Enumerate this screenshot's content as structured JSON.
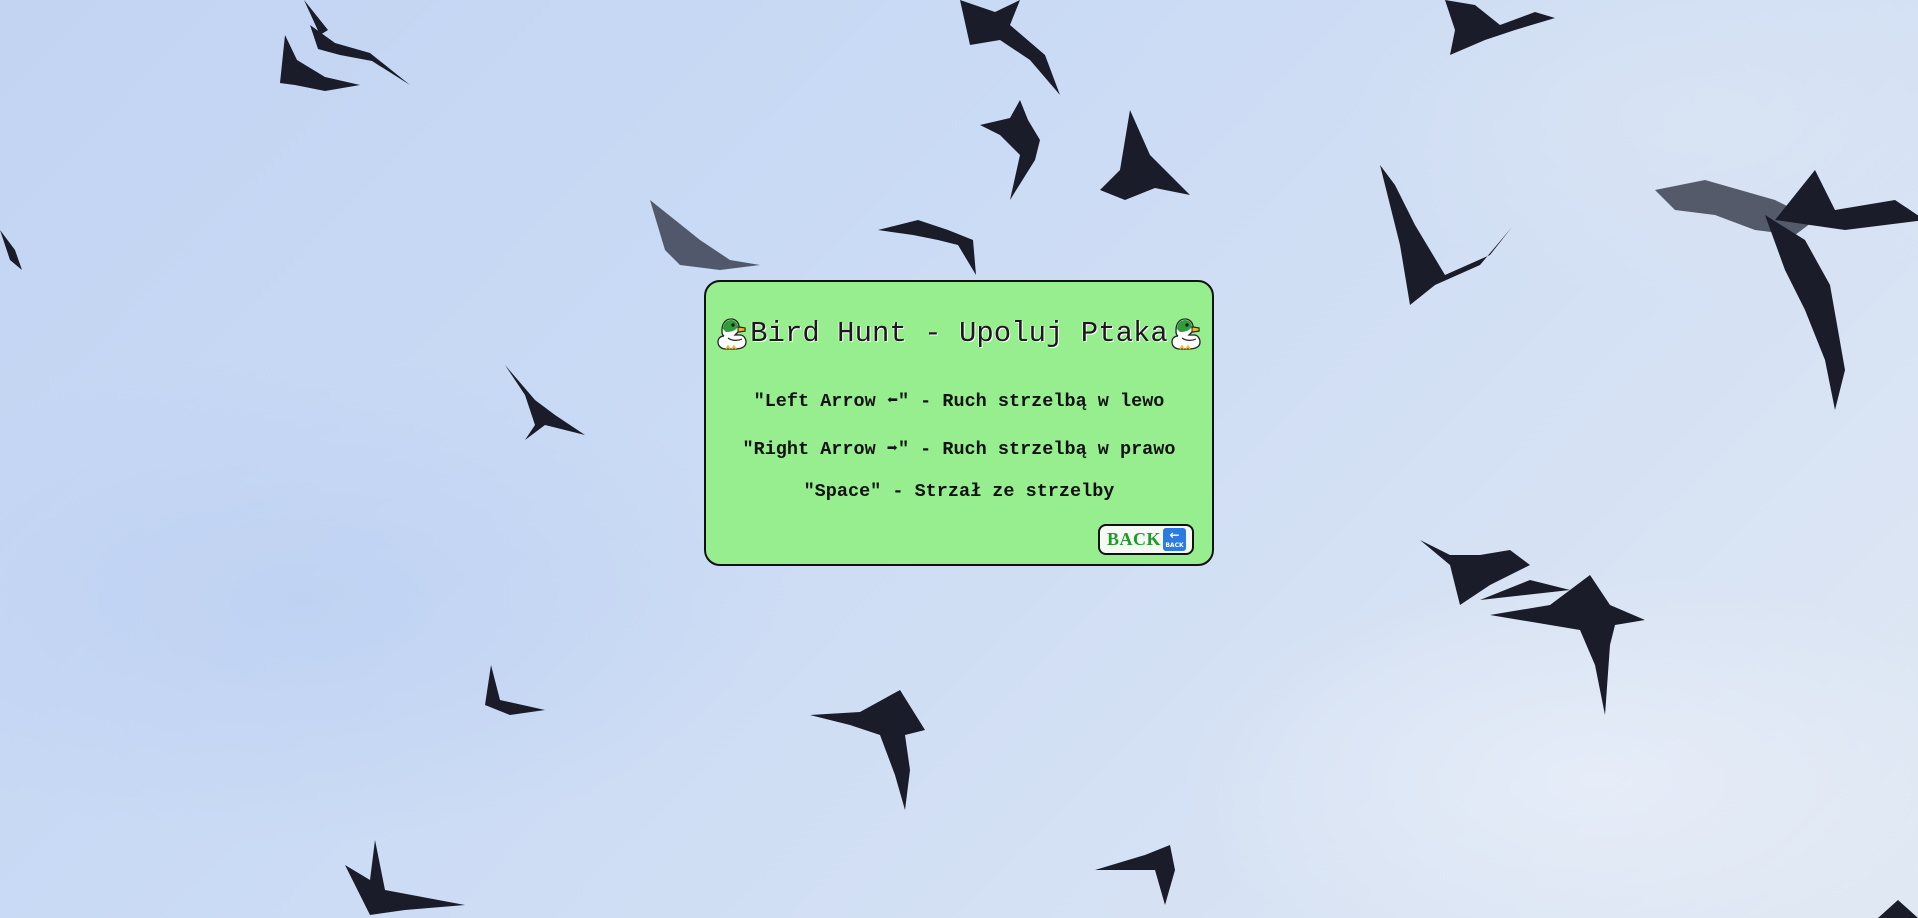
{
  "game": {
    "title": "Bird Hunt - Upoluj Ptaka",
    "title_icon": "duck-icon",
    "controls": [
      "\"Left Arrow ⬅\" - Ruch strzelbą w lewo",
      "\"Right Arrow ➡\" - Ruch strzelbą w prawo",
      "\"Space\" - Strzał ze strzelby"
    ],
    "back_button": {
      "label": "BACK",
      "icon": "back-icon",
      "icon_text": "BACK"
    }
  },
  "colors": {
    "panel_background": "#96ee8e",
    "panel_border": "#111111",
    "back_label": "#1f9a2a",
    "back_icon": "#2c7be0",
    "sky": "#c9daf5"
  }
}
